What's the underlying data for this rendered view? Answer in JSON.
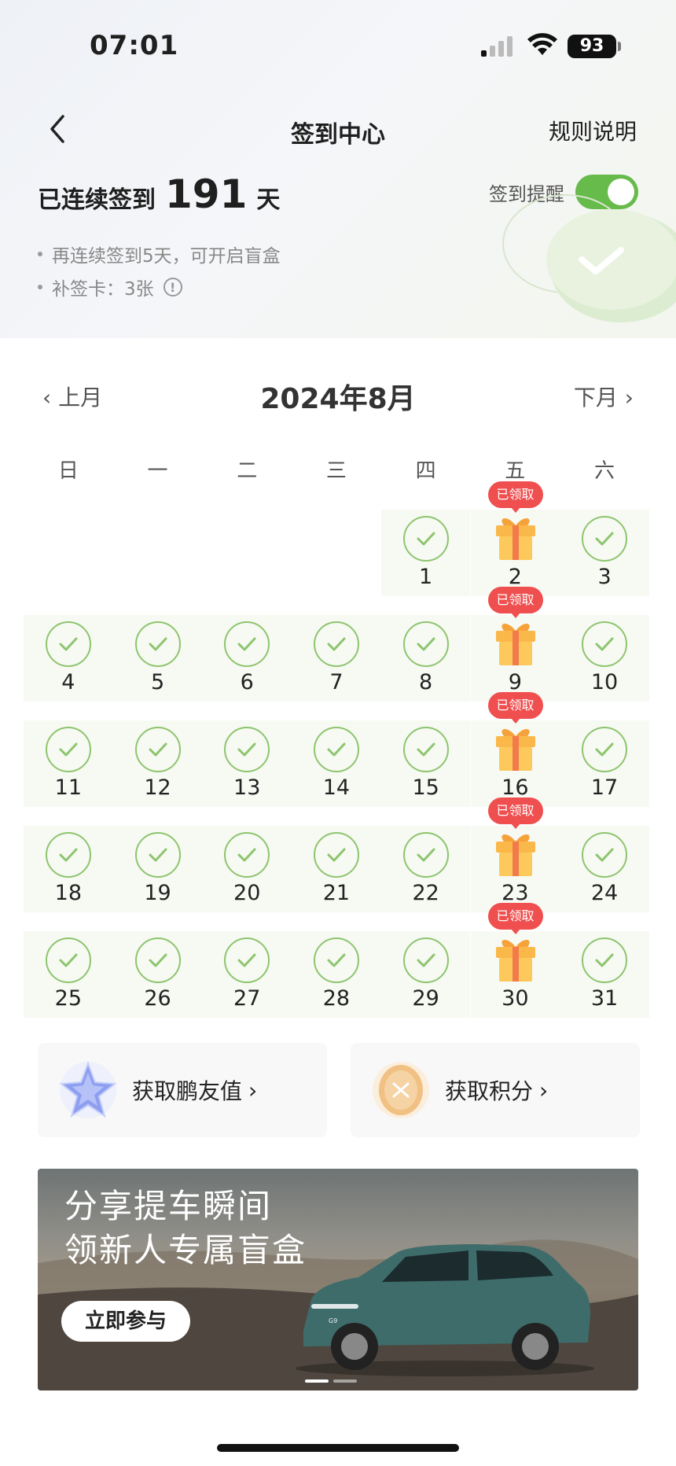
{
  "status_bar": {
    "time": "07:01",
    "battery": "93"
  },
  "nav": {
    "title": "签到中心",
    "rules_label": "规则说明"
  },
  "streak": {
    "prefix": "已连续签到",
    "days": "191",
    "suffix": "天"
  },
  "reminder": {
    "label": "签到提醒",
    "enabled": true
  },
  "tips": [
    {
      "text": "再连续签到5天，可开启盲盒"
    },
    {
      "text": "补签卡：3张"
    }
  ],
  "calendar": {
    "prev_label": "上月",
    "next_label": "下月",
    "title": "2024年8月",
    "weekdays": [
      "日",
      "一",
      "二",
      "三",
      "四",
      "五",
      "六"
    ],
    "claimed_label": "已领取",
    "weeks": [
      [
        "",
        "",
        "",
        "",
        "1",
        "2",
        "3"
      ],
      [
        "4",
        "5",
        "6",
        "7",
        "8",
        "9",
        "10"
      ],
      [
        "11",
        "12",
        "13",
        "14",
        "15",
        "16",
        "17"
      ],
      [
        "18",
        "19",
        "20",
        "21",
        "22",
        "23",
        "24"
      ],
      [
        "25",
        "26",
        "27",
        "28",
        "29",
        "30",
        "31"
      ]
    ],
    "gift_days": [
      "2",
      "9",
      "16",
      "23",
      "30"
    ]
  },
  "cards": [
    {
      "label": "获取鹏友值",
      "icon": "star-crystal-icon"
    },
    {
      "label": "获取积分",
      "icon": "coin-icon"
    }
  ],
  "banner": {
    "line1": "分享提车瞬间",
    "line2": "领新人专属盲盒",
    "button": "立即参与",
    "car_badge": "G9",
    "pages": 2,
    "active_page": 1
  },
  "colors": {
    "accent_green": "#66bb4a",
    "check_green": "#8dc56e",
    "tag_red": "#f04f4f"
  }
}
